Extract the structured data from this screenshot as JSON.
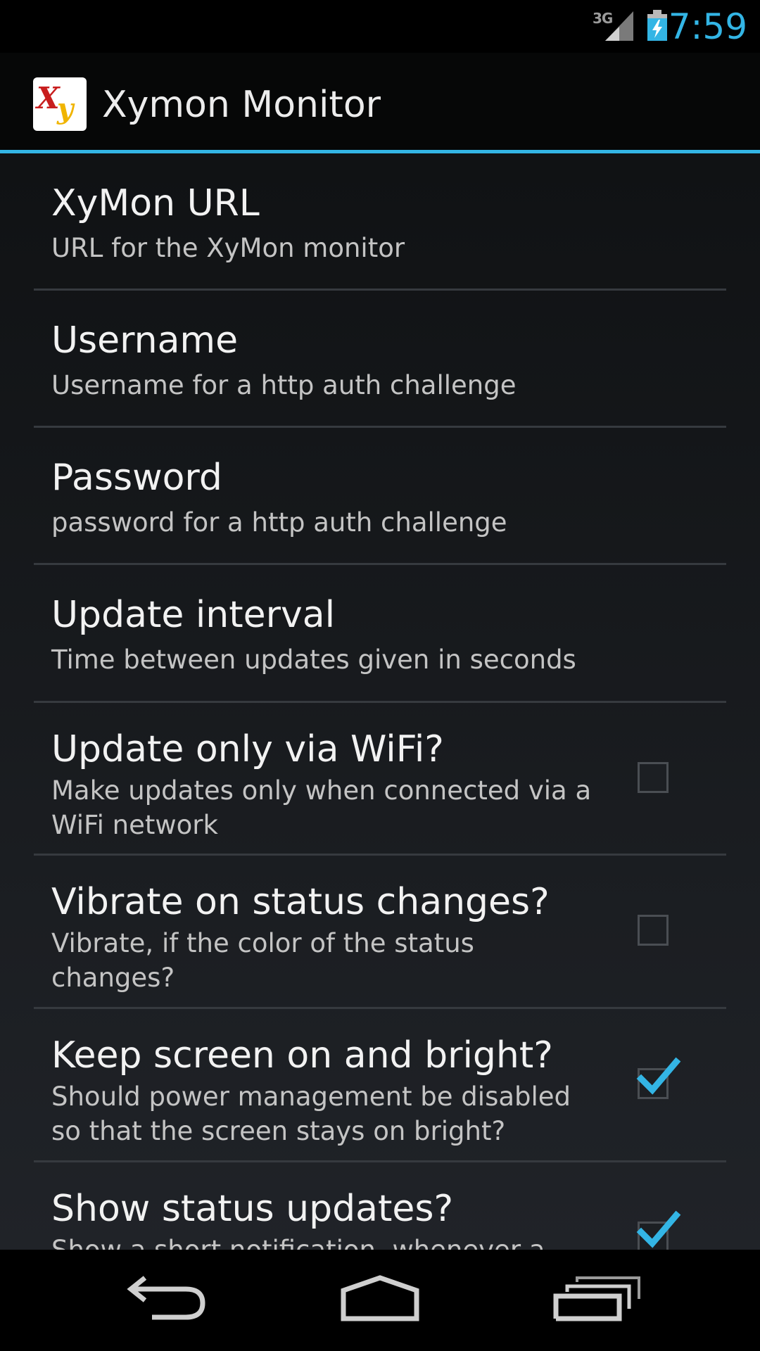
{
  "status_bar": {
    "network": "3G",
    "signal_icon": "signal-icon",
    "battery_icon": "battery-charging-icon",
    "time": "7:59",
    "accent": "#33b5e5"
  },
  "action_bar": {
    "logo_text": "Xy",
    "title": "Xymon Monitor"
  },
  "preferences": [
    {
      "title": "XyMon URL",
      "summary": "URL for the XyMon monitor"
    },
    {
      "title": "Username",
      "summary": "Username for a http auth challenge"
    },
    {
      "title": "Password",
      "summary": "password for a http auth challenge"
    },
    {
      "title": "Update interval",
      "summary": "Time between updates given in seconds"
    },
    {
      "title": "Update only via WiFi?",
      "summary": "Make updates only when connected via a WiFi network",
      "checked": false
    },
    {
      "title": "Vibrate on status changes?",
      "summary": "Vibrate, if the color of the status changes?",
      "checked": false
    },
    {
      "title": "Keep screen on and bright?",
      "summary": "Should power management be disabled so that the screen stays on bright?",
      "checked": true
    },
    {
      "title": "Show status updates?",
      "summary": "Show a short notification, whenever a",
      "checked": true
    }
  ],
  "nav_bar": {
    "back_icon": "back-icon",
    "home_icon": "home-icon",
    "recents_icon": "recents-icon"
  }
}
